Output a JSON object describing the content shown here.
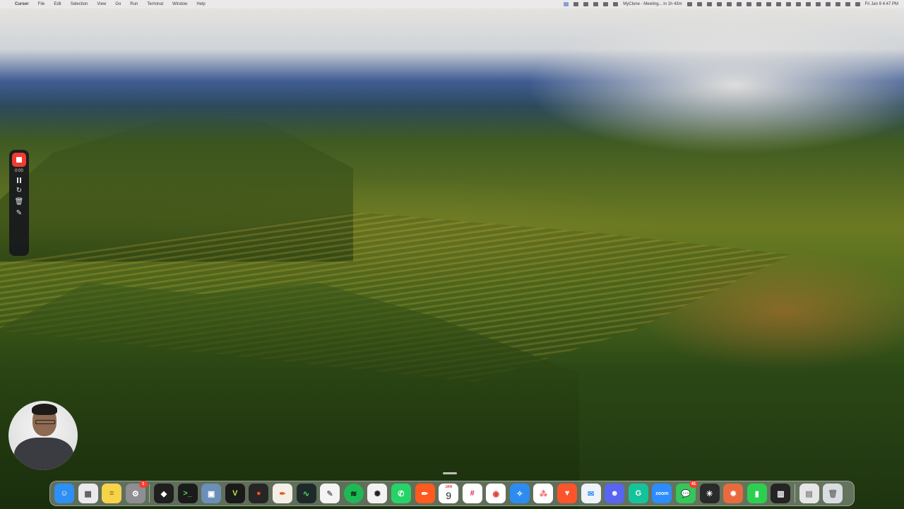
{
  "menubar": {
    "app_name": "Cursor",
    "menus": [
      "File",
      "Edit",
      "Selection",
      "View",
      "Go",
      "Run",
      "Terminal",
      "Window",
      "Help"
    ],
    "meeting_status": "MyClone - Meeting... in 1h 43m",
    "clock": "Fri Jan 9  4:47 PM"
  },
  "recorder": {
    "elapsed": "0:00",
    "record_color": "#ef3b30"
  },
  "dock": {
    "calendar_month": "JAN",
    "calendar_day": "9",
    "settings_badge": "1",
    "messages_badge": "41",
    "zoom_label": "zoom",
    "items": [
      {
        "name": "finder-icon",
        "color": "#2e8ff5"
      },
      {
        "name": "launchpad-icon",
        "color": "#e9e9ee"
      },
      {
        "name": "notes-icon",
        "color": "#f7d34a"
      },
      {
        "name": "system-settings-icon",
        "color": "#8e8e93"
      },
      {
        "name": "cursor-app-icon",
        "color": "#1f1f1f"
      },
      {
        "name": "terminal-icon",
        "color": "#1b1b1b"
      },
      {
        "name": "preview-icon",
        "color": "#6b8fb8"
      },
      {
        "name": "vy-app-icon",
        "color": "#1a1a1a"
      },
      {
        "name": "figma-icon",
        "color": "#262626"
      },
      {
        "name": "feather-app-icon",
        "color": "#f3efe6"
      },
      {
        "name": "activity-monitor-icon",
        "color": "#1e2a2a"
      },
      {
        "name": "textedit-icon",
        "color": "#f4f4f4"
      },
      {
        "name": "spotify-icon",
        "color": "#1db954"
      },
      {
        "name": "chatgpt-icon",
        "color": "#f2f2f2"
      },
      {
        "name": "whatsapp-icon",
        "color": "#25d366"
      },
      {
        "name": "pencil-app-icon",
        "color": "#ff5a1f"
      },
      {
        "name": "calendar-icon",
        "color": "#ffffff"
      },
      {
        "name": "slack-icon",
        "color": "#ffffff"
      },
      {
        "name": "chrome-icon",
        "color": "#ffffff"
      },
      {
        "name": "safari-icon",
        "color": "#2d8cf0"
      },
      {
        "name": "asana-icon",
        "color": "#ffffff"
      },
      {
        "name": "brave-icon",
        "color": "#fb542b"
      },
      {
        "name": "mail-icon",
        "color": "#eef3f8"
      },
      {
        "name": "discord-icon",
        "color": "#5865f2"
      },
      {
        "name": "grammarly-icon",
        "color": "#15c39a"
      },
      {
        "name": "zoom-icon",
        "color": "#2d8cff"
      },
      {
        "name": "messages-icon",
        "color": "#34c759"
      },
      {
        "name": "perplexity-icon",
        "color": "#2a2a2a"
      },
      {
        "name": "claude-icon",
        "color": "#e86a3e"
      },
      {
        "name": "numbers-icon",
        "color": "#2ccf4f"
      },
      {
        "name": "istat-menus-icon",
        "color": "#242424"
      },
      {
        "name": "files-icon",
        "color": "#e6e6e6"
      },
      {
        "name": "trash-icon",
        "color": "#d9dde2"
      }
    ]
  }
}
